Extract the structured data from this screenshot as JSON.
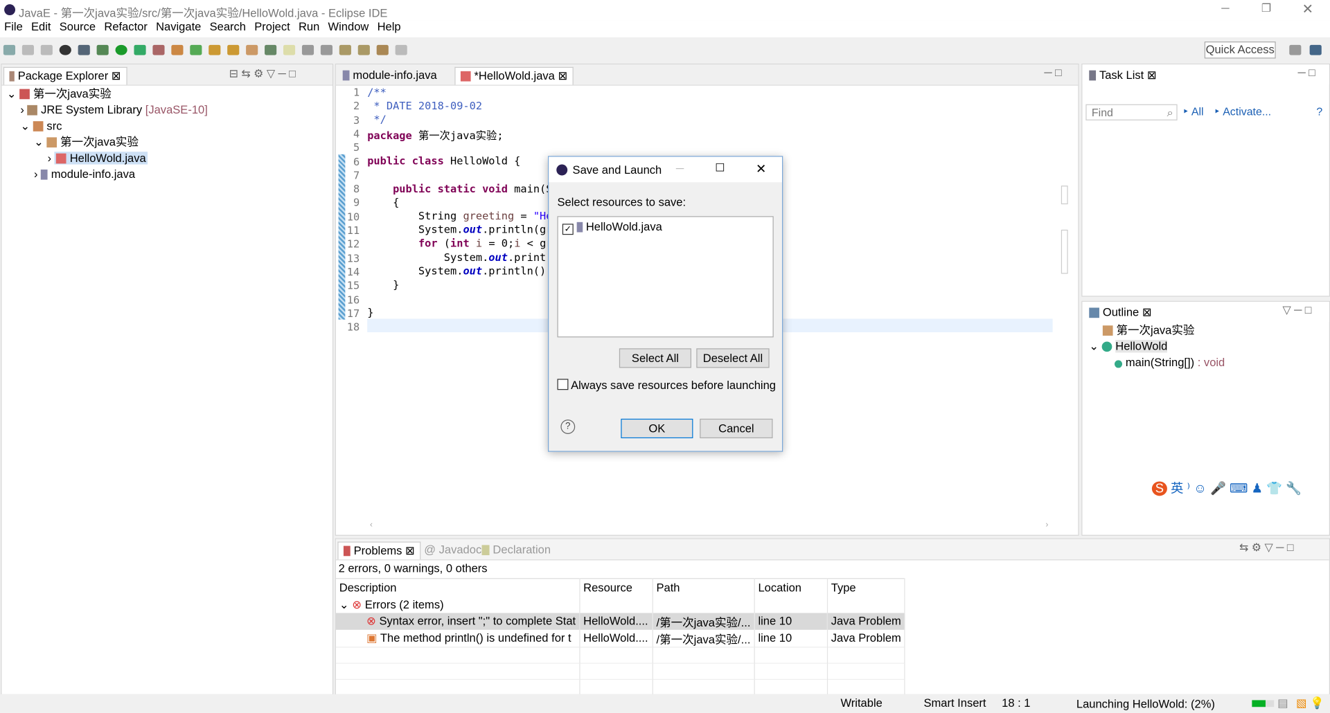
{
  "window": {
    "title": "JavaE - 第一次java实验/src/第一次java实验/HelloWold.java - Eclipse IDE"
  },
  "menu": [
    "File",
    "Edit",
    "Source",
    "Refactor",
    "Navigate",
    "Search",
    "Project",
    "Run",
    "Window",
    "Help"
  ],
  "toolbar": {
    "quick_access": "Quick Access"
  },
  "package_explorer": {
    "title": "Package Explorer",
    "items": [
      {
        "label": "第一次java实验"
      },
      {
        "label": "JRE System Library",
        "extra": "[JavaSE-10]"
      },
      {
        "label": "src"
      },
      {
        "label": "第一次java实验"
      },
      {
        "label": "HelloWold.java"
      },
      {
        "label": "module-info.java"
      }
    ]
  },
  "editor": {
    "tabs": [
      {
        "label": "module-info.java"
      },
      {
        "label": "*HelloWold.java"
      }
    ],
    "lines": [
      "1",
      "2",
      "3",
      "4",
      "5",
      "6",
      "7",
      "8",
      "9",
      "10",
      "11",
      "12",
      "13",
      "14",
      "15",
      "16",
      "17",
      "18"
    ]
  },
  "dialog": {
    "title": "Save and Launch",
    "prompt": "Select resources to save:",
    "resources": [
      {
        "label": "HelloWold.java",
        "checked": true
      }
    ],
    "select_all": "Select All",
    "deselect_all": "Deselect All",
    "always_save": "Always save resources before launching",
    "always_save_checked": false,
    "ok": "OK",
    "cancel": "Cancel",
    "help": "?"
  },
  "task_list": {
    "title": "Task List",
    "find_placeholder": "Find",
    "all": "All",
    "activate": "Activate..."
  },
  "outline": {
    "title": "Outline",
    "items": [
      {
        "label": "第一次java实验"
      },
      {
        "label": "HelloWold"
      },
      {
        "label": "main(String[])",
        "type": ": void"
      }
    ]
  },
  "ime": {
    "lang": "英"
  },
  "problems": {
    "tabs": [
      "Problems",
      "Javadoc",
      "Declaration"
    ],
    "summary": "2 errors, 0 warnings, 0 others",
    "columns": [
      "Description",
      "Resource",
      "Path",
      "Location",
      "Type"
    ],
    "group": "Errors (2 items)",
    "rows": [
      {
        "description": "Syntax error, insert \";\" to complete Stat",
        "resource": "HelloWold....",
        "path": "/第一次java实验/...",
        "location": "line 10",
        "type": "Java Problem"
      },
      {
        "description": "The method println() is undefined for t",
        "resource": "HelloWold....",
        "path": "/第一次java实验/...",
        "location": "line 10",
        "type": "Java Problem"
      }
    ]
  },
  "status": {
    "writable": "Writable",
    "insert": "Smart Insert",
    "position": "18 : 1",
    "launching": "Launching HelloWold: (2%)",
    "progress_percent": 2
  }
}
